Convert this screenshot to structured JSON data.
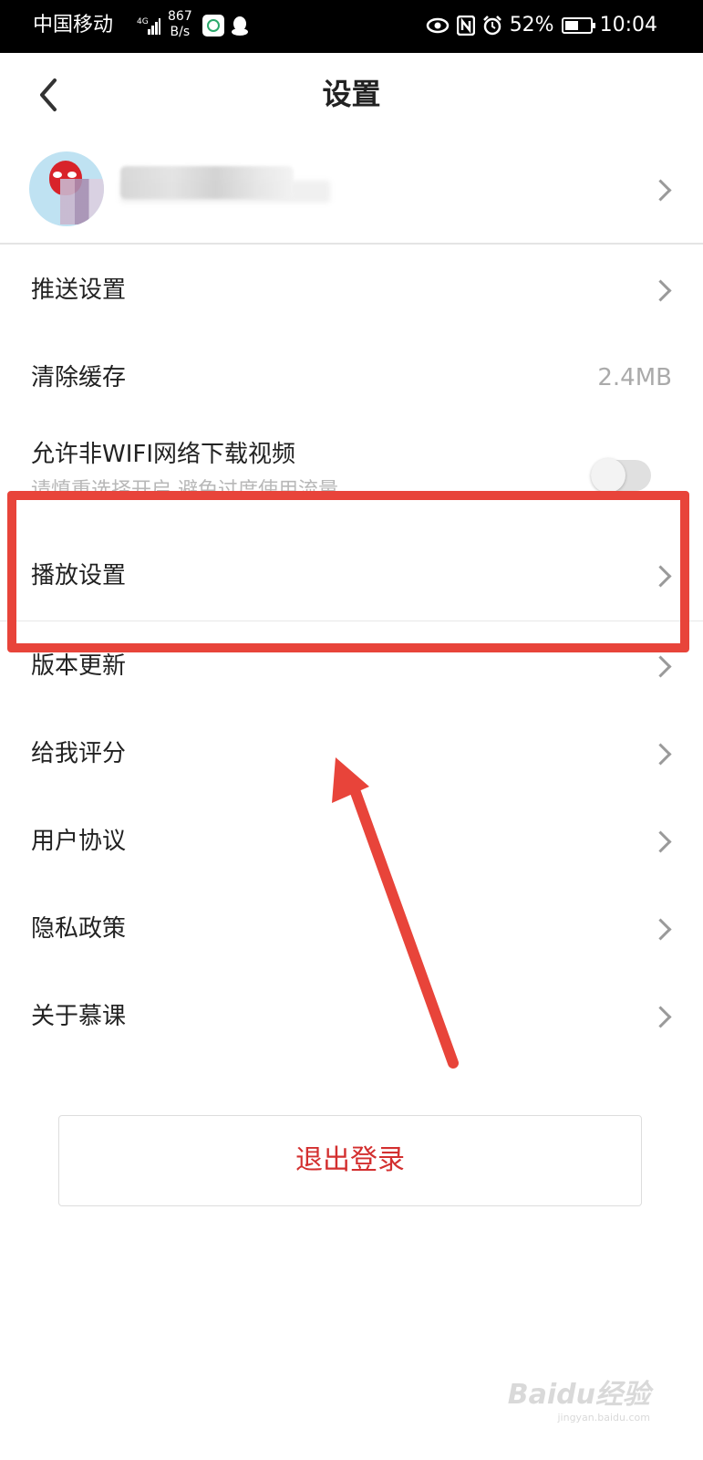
{
  "status_bar": {
    "carrier": "中国移动",
    "net_speed_value": "867",
    "net_speed_unit": "B/s",
    "battery": "52%",
    "time": "10:04"
  },
  "header": {
    "title": "设置"
  },
  "settings": {
    "push": "推送设置",
    "clear_cache": "清除缓存",
    "cache_size": "2.4MB",
    "wifi_download": "允许非WIFI网络下载视频",
    "wifi_download_sub": "请慎重选择开启 避免过度使用流量",
    "playback": "播放设置",
    "version_update": "版本更新",
    "rate_me": "给我评分",
    "user_agreement": "用户协议",
    "privacy_policy": "隐私政策",
    "about": "关于慕课"
  },
  "logout_label": "退出登录",
  "toggle_wifi_on": false,
  "watermark": {
    "text": "Baidu经验",
    "url": "jingyan.baidu.com"
  },
  "annotation_color": "#e8443a"
}
